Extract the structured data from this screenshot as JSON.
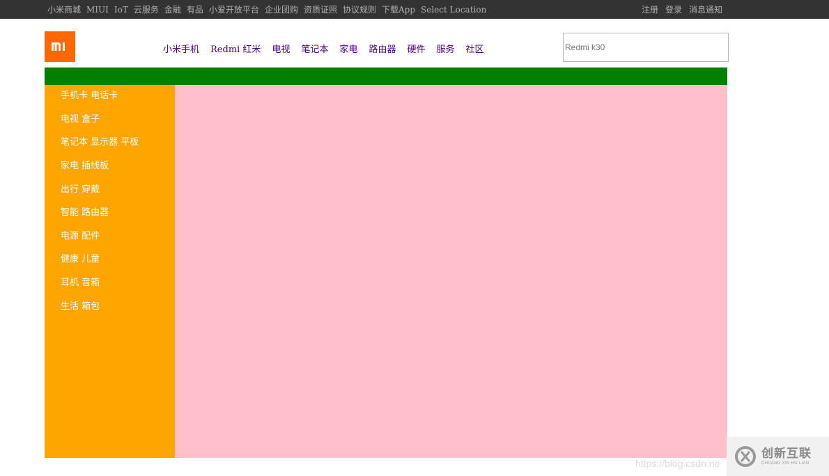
{
  "topbar": {
    "left_links": [
      "小米商城",
      "MIUI",
      "IoT",
      "云服务",
      "金融",
      "有品",
      "小爱开放平台",
      "企业团购",
      "资质证照",
      "协议规则",
      "下载App",
      "Select Location"
    ],
    "right_links": [
      "注册",
      "登录",
      "消息通知"
    ]
  },
  "header": {
    "logo_icon": "mi-logo-icon",
    "nav": [
      "小米手机",
      "Redmi 红米",
      "电视",
      "笔记本",
      "家电",
      "路由器",
      "硬件",
      "服务",
      "社区"
    ],
    "search_placeholder": "Redmi k30"
  },
  "sidebar": {
    "items": [
      "手机卡 电话卡",
      "电视 盒子",
      "笔记本 显示器 平板",
      "家电 插线板",
      "出行 穿戴",
      "智能 路由器",
      "电源 配件",
      "健康 儿童",
      "耳机 音箱",
      "生活 箱包"
    ]
  },
  "watermark": {
    "url": "https://blog.csdn.ne",
    "brand_cn": "创新互联",
    "brand_en": "CHUANG XIN HU LIAN"
  },
  "colors": {
    "topbar_bg": "#333333",
    "logo_bg": "#ff6700",
    "nav_text": "#4b0082",
    "green_band": "#008000",
    "sidebar_bg": "#ffa500",
    "panel_bg": "#ffc0cb"
  }
}
